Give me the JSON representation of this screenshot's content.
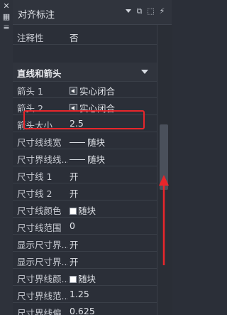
{
  "panel": {
    "title": "对齐标注"
  },
  "rows": {
    "annotative": {
      "label": "注释性",
      "value": "否"
    },
    "arrow1": {
      "label": "箭头 1",
      "value": "实心闭合"
    },
    "arrow2": {
      "label": "箭头 2",
      "value": "实心闭合"
    },
    "arrow_size": {
      "label": "箭头大小",
      "value": "2.5"
    },
    "dim_linewidth": {
      "label": "尺寸线线宽",
      "value": "随块"
    },
    "ext_linewidth": {
      "label": "尺寸界线线...",
      "value": "随块"
    },
    "dim_line1": {
      "label": "尺寸线 1",
      "value": "开"
    },
    "dim_line2": {
      "label": "尺寸线 2",
      "value": "开"
    },
    "dim_line_color": {
      "label": "尺寸线颜色",
      "value": "随块"
    },
    "dim_line_ext": {
      "label": "尺寸线范围",
      "value": "0"
    },
    "show_ext1": {
      "label": "显示尺寸界...",
      "value": "开"
    },
    "show_ext2": {
      "label": "显示尺寸界...",
      "value": "开"
    },
    "ext_color": {
      "label": "尺寸界线颜...",
      "value": "随块"
    },
    "ext_range": {
      "label": "尺寸界线范...",
      "value": "1.25"
    },
    "ext_offset": {
      "label": "尺寸界线偏...",
      "value": "0.625"
    }
  },
  "section": {
    "label": "直线和箭头"
  },
  "colors": {
    "highlight": "#e8262b",
    "panel_bg": "#2b2f38"
  },
  "icons": [
    "pin-icon",
    "properties-icon",
    "select-objects-icon",
    "quick-select-icon",
    "toggle-pickadd-icon",
    "scroll-up-arrow"
  ]
}
